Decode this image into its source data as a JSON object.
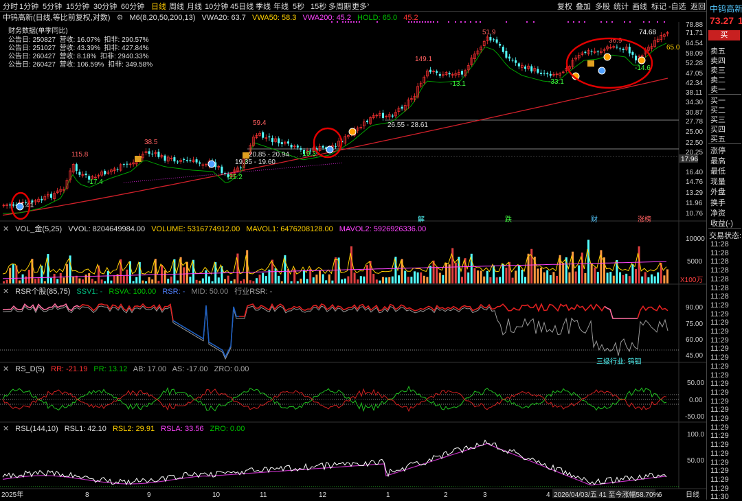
{
  "periods": [
    "分时",
    "1分钟",
    "5分钟",
    "15分钟",
    "30分钟",
    "60分钟",
    "日线",
    "周线",
    "月线",
    "10分钟",
    "45日线",
    "季线",
    "年线",
    "5秒",
    "15秒",
    "多周期",
    "更多"
  ],
  "active_period": "日线",
  "toolbar": [
    "复权",
    "叠加",
    "多股",
    "统计",
    "画线",
    "标记"
  ],
  "back_label": "-自选",
  "return_label": "返回",
  "stock": {
    "name": "中钨高新",
    "price": "73.27",
    "price_suffix": "1",
    "buy_button": "买",
    "title_line": "中钨高新(日线,等比前复权,对数)"
  },
  "order_book": [
    "卖五",
    "卖四",
    "卖三",
    "卖二",
    "卖一",
    "买一",
    "买二",
    "买三",
    "买四",
    "买五"
  ],
  "info_labels": [
    "涨停",
    "最高",
    "最低",
    "现量",
    "外盘",
    "换手",
    "净资",
    "收益(-)"
  ],
  "trade_status": "交易状态:",
  "trade_times": [
    "11:28",
    "11:28",
    "11:28",
    "11:28",
    "11:28",
    "11:28",
    "11:28",
    "11:29",
    "11:29",
    "11:29",
    "11:29",
    "11:29",
    "11:29",
    "11:29",
    "11:29",
    "11:29",
    "11:29",
    "11:29",
    "11:29",
    "11:29",
    "11:29",
    "11:29",
    "11:29",
    "11:29",
    "11:29",
    "11:29",
    "11:29",
    "11:29",
    "11:29",
    "11:30"
  ],
  "main_indicator": {
    "name": "M6(8,20,50,200,13)",
    "vwa20": "VWA20: 63.7",
    "vwa50": "VWA50: 58.3",
    "vwa200": "VWA200: 45.2",
    "hold": "HOLD: 65.0",
    "hold2": "45.2"
  },
  "financial": {
    "title": "财务数据(单季同比)",
    "rows": [
      "公告日: 250827  营收: 16.07%  扣非: 290.57%",
      "公告日: 251027  营收: 43.39%  扣非: 427.84%",
      "公告日: 260427  营收: 8.18%  扣非: 2940.33%",
      "公告日: 260427  营收: 106.59%  扣非: 349.58%"
    ]
  },
  "price_axis": [
    "78.88",
    "71.71",
    "64.54",
    "58.09",
    "52.28",
    "47.05",
    "42.34",
    "38.11",
    "34.30",
    "30.87",
    "27.78",
    "25.00",
    "22.50",
    "20.25",
    "17.96",
    "16.40",
    "14.76",
    "13.29",
    "11.96",
    "10.76"
  ],
  "price_annotations": {
    "high1": "115.8",
    "low1": "-17.4",
    "high2": "38.5",
    "low2": "-25.2",
    "high3": "59.4",
    "low3": "-19.3",
    "high4": "149.1",
    "low4": "-13.1",
    "high5": "51.9",
    "low5": "-33.1",
    "high6": "36.9",
    "low6": "-14.6",
    "peak": "74.68",
    "start": "11.41",
    "hold_label": "65.0",
    "range1": "26.55 - 28.61",
    "range2": "20.85 - 20.94",
    "range3": "19.35 - 19.60",
    "marker_jie": "解",
    "marker_die": "跌",
    "marker_cai": "财",
    "marker_zhang": "涨榜"
  },
  "volume": {
    "name": "VOL_金(5,25)",
    "vvol": "VVOL: 8204649984.00",
    "volume": "VOLUME: 5316774912.00",
    "mavol1": "MAVOL1: 6476208128.00",
    "mavol2": "MAVOL2: 5926926336.00",
    "axis": [
      "10000",
      "5000"
    ],
    "unit": "X100万"
  },
  "rsr": {
    "name": "RSR个股(85,75)",
    "ssv": "SSV1: -",
    "rsva": "RSVA: 100.00",
    "rsr": "RSR: -",
    "mid": "MID: 50.00",
    "ind": "行业RSR: -",
    "axis": [
      "90.00",
      "75.00",
      "60.00",
      "45.00"
    ],
    "industry_label": "三级行业: 钨钼"
  },
  "rsd": {
    "name": "RS_D(5)",
    "rr": "RR: -21.19",
    "pr": "PR: 13.12",
    "ab": "AB: 17.00",
    "as": "AS: -17.00",
    "zro": "ZRO: 0.00",
    "axis": [
      "50.00",
      "0.00",
      "-50.00"
    ]
  },
  "rsl": {
    "name": "RSL(144,10)",
    "rsl1": "RSL1: 42.10",
    "rsl2": "RSL2: 29.91",
    "rsla": "RSLA: 33.56",
    "zro": "ZRO: 0.00",
    "axis": [
      "100.0",
      "50.00"
    ]
  },
  "date_axis": {
    "labels": [
      "2025年",
      "8",
      "9",
      "10",
      "11",
      "12",
      "1",
      "2",
      "3",
      "4",
      "6"
    ],
    "cursor_date": "2026/04/03/五 41 至今涨幅58.70%",
    "freq": "日线"
  },
  "colors": {
    "up": "#ff3232",
    "down": "#54ffff",
    "ma_red": "#e0202a",
    "hold": "#00a000",
    "yellow": "#ffd000",
    "magenta": "#ff44ff",
    "circle": "#e00000"
  }
}
